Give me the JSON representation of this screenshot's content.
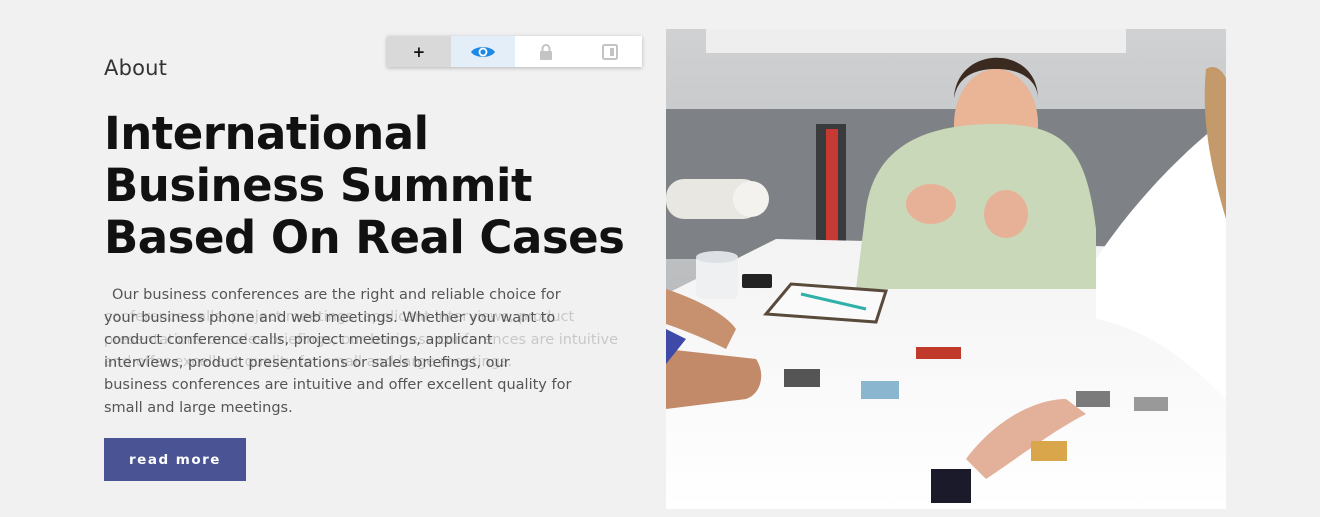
{
  "section": {
    "eyebrow": "About"
  },
  "headline": {
    "lines": [
      "International",
      "Business Summit",
      "Based On Real Cases"
    ]
  },
  "body": {
    "text": "Our business conferences are the right and reliable choice for your business phone and web meetings. Whether you want to conduct conference calls, project meetings, applicant interviews, product presentations or sales briefings, our business conferences are intuitive and offer excellent quality for small and large meetings.",
    "ghost_text": "conference calls, project meetings, applicant interviews, product presentations or sales briefings, our business conferences are intuitive and offer excellent quality for small and large meetings."
  },
  "cta": {
    "label": "read more"
  },
  "toolbar": {
    "buttons": [
      {
        "label": "+",
        "icon": "plus-icon"
      },
      {
        "icon": "eye-icon"
      },
      {
        "icon": "lock-icon"
      },
      {
        "icon": "layer-icon"
      }
    ]
  },
  "photo": {
    "description_icon": "meeting-photo"
  },
  "colors": {
    "background": "#f1f1f1",
    "button": "#4a5494",
    "eye_accent": "#1e88e5",
    "toolbar_icon_muted": "#c4c4c4"
  }
}
